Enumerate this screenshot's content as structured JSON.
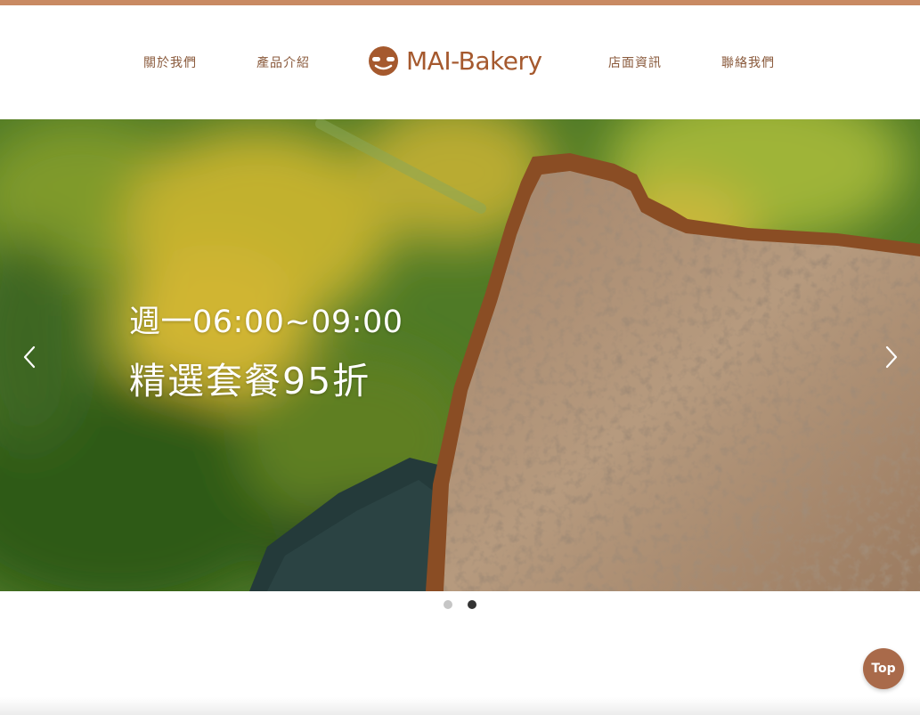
{
  "colors": {
    "accent_bar": "#c98a63",
    "nav_text": "#8a5a3c",
    "logo_brown": "#a5592e",
    "top_button": "#a96a4a",
    "dot_inactive": "#c6c6c6",
    "dot_active": "#333333"
  },
  "nav": {
    "about": "關於我們",
    "products": "產品介紹",
    "store_info": "店面資訊",
    "contact": "聯絡我們"
  },
  "logo": {
    "text": "MAI-Bakery",
    "icon": "bread-face-icon"
  },
  "hero": {
    "line1": "週一06:00~09:00",
    "line2": "精選套餐95折",
    "prev_icon": "chevron-left-icon",
    "next_icon": "chevron-right-icon",
    "slide_count": 2,
    "active_slide": 2
  },
  "back_to_top": {
    "label": "Top"
  }
}
